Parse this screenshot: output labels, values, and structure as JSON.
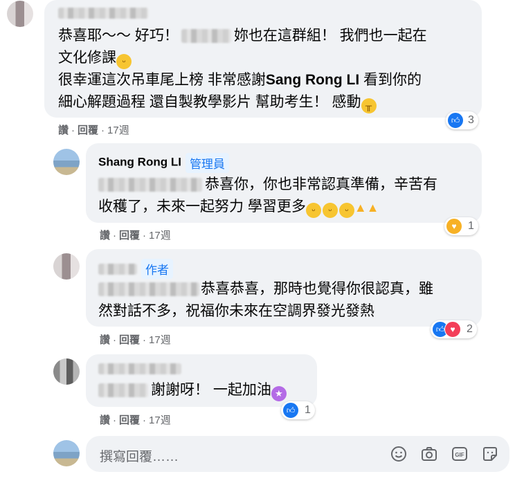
{
  "comments": [
    {
      "lines": [
        "恭喜耶～～ 好巧！",
        "妳也在這群組！ 我們也一起在",
        "文化修課",
        "很幸運這次吊車尾上榜 非常感謝",
        "Sang Rong LI",
        "看到你的",
        "細心解題過程 還自製教學影片 幫助考生！ 感動"
      ],
      "actions": {
        "like": "讚",
        "reply": "回覆",
        "time": "17週"
      },
      "reaction_count": "3"
    },
    {
      "author": "Shang Rong LI",
      "badge": "管理員",
      "lines": [
        "恭喜你，你也非常認真準備，辛苦有",
        "收穫了，未來一起努力 學習更多"
      ],
      "actions": {
        "like": "讚",
        "reply": "回覆",
        "time": "17週"
      },
      "reaction_count": "1"
    },
    {
      "badge": "作者",
      "lines": [
        "恭喜恭喜，那時也覺得你很認真，雖",
        "然對話不多，祝福你未來在空調界發光發熱"
      ],
      "actions": {
        "like": "讚",
        "reply": "回覆",
        "time": "17週"
      },
      "reaction_count": "2"
    },
    {
      "lines": [
        "謝謝呀！ 一起加油"
      ],
      "actions": {
        "like": "讚",
        "reply": "回覆",
        "time": "17週"
      },
      "reaction_count": "1"
    }
  ],
  "reply_box": {
    "placeholder": "撰寫回覆……"
  },
  "icons": [
    "like-icon",
    "love-icon",
    "care-icon",
    "emoji-icon",
    "camera-icon",
    "gif-icon",
    "sticker-icon"
  ]
}
